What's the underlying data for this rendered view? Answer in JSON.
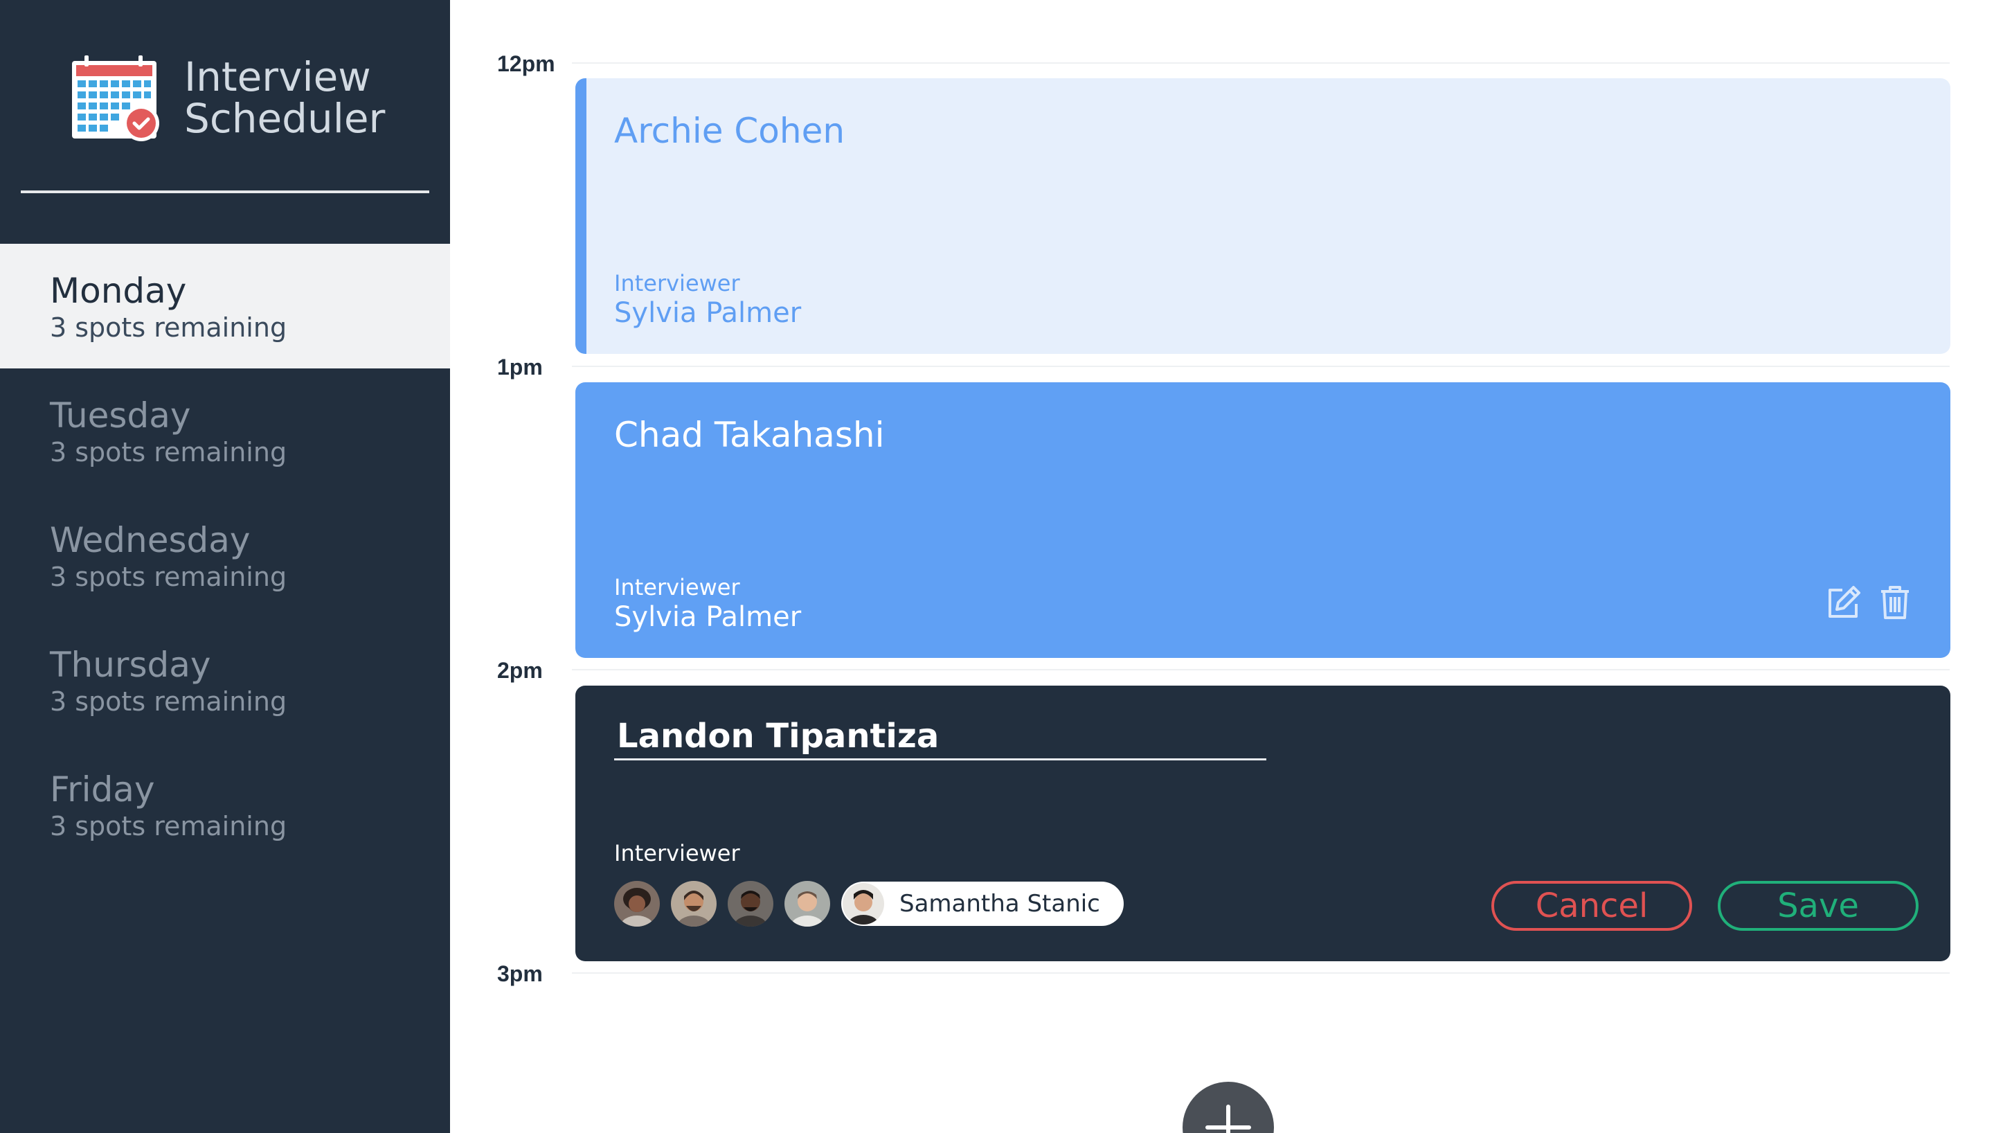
{
  "app": {
    "title_line1": "Interview",
    "title_line2": "Scheduler",
    "logo_icon": "calendar-check-icon"
  },
  "sidebar": {
    "days": [
      {
        "name": "Monday",
        "spots": "3 spots remaining",
        "selected": true
      },
      {
        "name": "Tuesday",
        "spots": "3 spots remaining",
        "selected": false
      },
      {
        "name": "Wednesday",
        "spots": "3 spots remaining",
        "selected": false
      },
      {
        "name": "Thursday",
        "spots": "3 spots remaining",
        "selected": false
      },
      {
        "name": "Friday",
        "spots": "3 spots remaining",
        "selected": false
      }
    ]
  },
  "schedule": {
    "times": [
      "12pm",
      "1pm",
      "2pm",
      "3pm"
    ],
    "appointments": [
      {
        "student": "Archie Cohen",
        "interviewer_label": "Interviewer",
        "interviewer": "Sylvia Palmer",
        "state": "show"
      },
      {
        "student": "Chad Takahashi",
        "interviewer_label": "Interviewer",
        "interviewer": "Sylvia Palmer",
        "state": "show-hover",
        "actions": [
          "edit-icon",
          "trash-icon"
        ]
      },
      {
        "student_input_value": "Landon Tipantiza",
        "interviewer_label": "Interviewer",
        "selected_interviewer": "Samantha Stanic",
        "state": "edit",
        "cancel_label": "Cancel",
        "save_label": "Save"
      }
    ],
    "add_icon": "plus-icon"
  },
  "colors": {
    "sidebar_bg": "#222f3e",
    "accent_blue": "#60a0f4",
    "light_blue": "#e6effc",
    "cancel_red": "#e05252",
    "save_green": "#20b07a"
  }
}
